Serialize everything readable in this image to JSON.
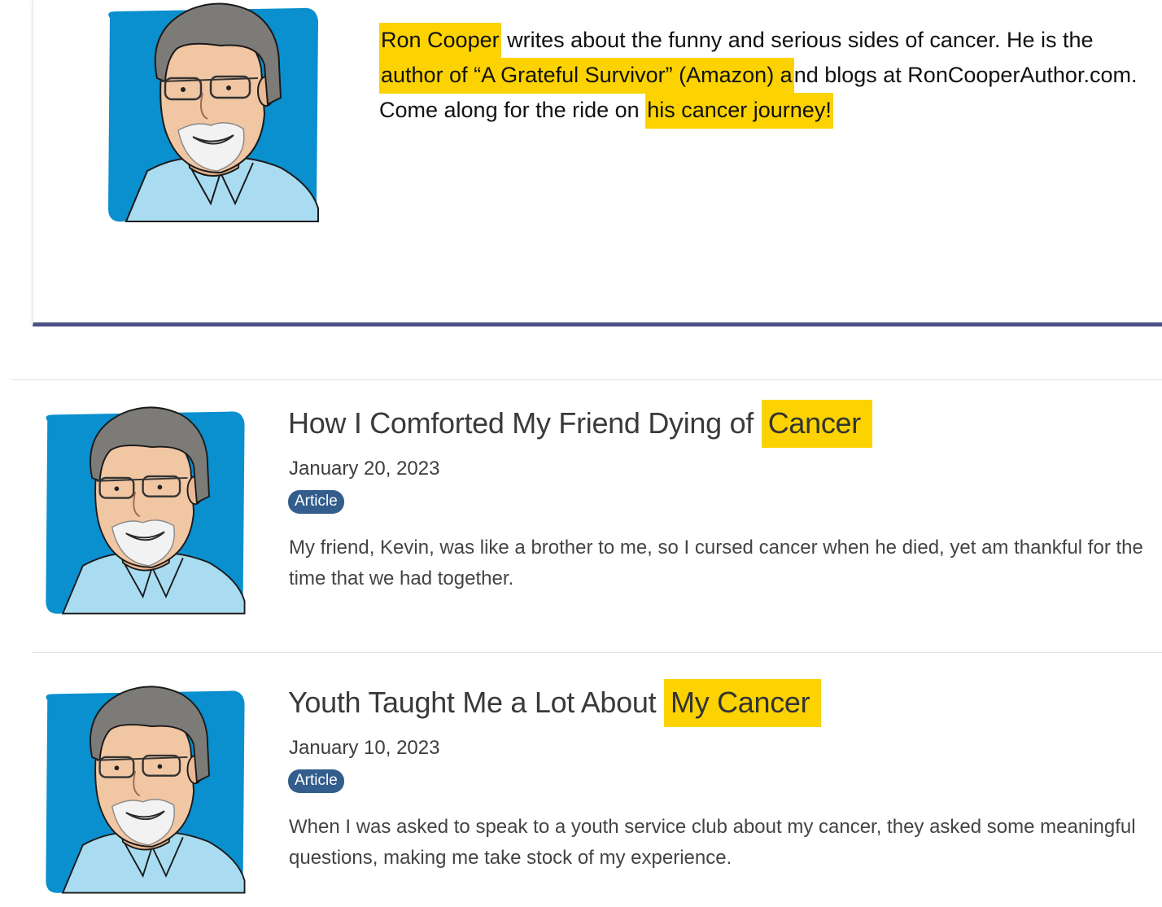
{
  "author_bio": {
    "name": "Ron Cooper",
    "text_1": " writes about the funny and serious sides of cancer. He is the ",
    "book": "author of “A Grateful Survivor” (Amazon) a",
    "text_2": "nd blogs at RonCooperAuthor.com. Come along for the ride on ",
    "journey": "his cancer journey!"
  },
  "articles": [
    {
      "title_prefix": "How I Comforted My Friend Dying of",
      "title_highlight": "Cancer",
      "date": "January 20, 2023",
      "badge": "Article",
      "excerpt": "My friend, Kevin, was like a brother to me, so I cursed cancer when he died, yet am thankful for the time that we had together."
    },
    {
      "title_prefix": "Youth Taught Me a Lot About",
      "title_highlight": "My Cancer",
      "date": "January 10, 2023",
      "badge": "Article",
      "excerpt": "When I was asked to speak to a youth service club about my cancer, they asked some meaningful questions, making me take stock of my experience."
    }
  ],
  "colors": {
    "highlight": "#fcd300",
    "badge": "#325d8c",
    "card_border": "#4a5285",
    "avatar_bg": "#0a8fcf"
  }
}
